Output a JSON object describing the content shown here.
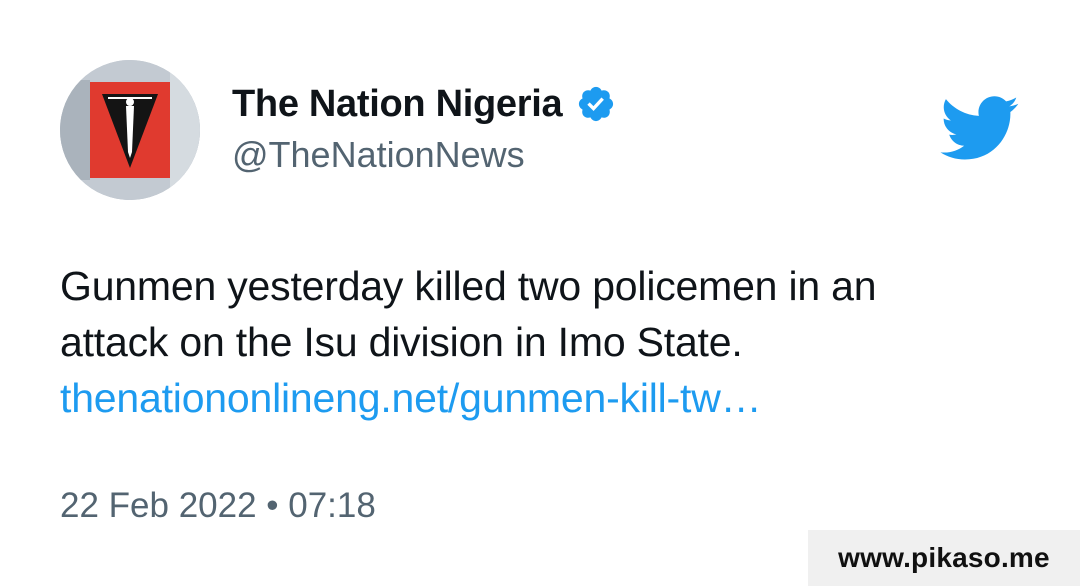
{
  "author": {
    "name": "The Nation Nigeria",
    "handle": "@TheNationNews",
    "verified": true,
    "avatar_icon": "the-nation-logo-icon"
  },
  "tweet": {
    "text_line_1": "Gunmen yesterday killed two policemen in an",
    "text_line_2": "attack on the Isu division in Imo State.",
    "link_text": "thenationonlineng.net/gunmen-kill-tw…",
    "timestamp": "22 Feb 2022 • 07:18"
  },
  "watermark": {
    "text": "www.pikaso.me"
  },
  "icons": {
    "verified": "verified-badge-icon",
    "platform": "twitter-bird-icon"
  },
  "colors": {
    "text_primary": "#0f1419",
    "text_secondary": "#536471",
    "link": "#1d9bf0",
    "brand_blue": "#1d9bf0",
    "logo_red": "#e03a2f"
  }
}
